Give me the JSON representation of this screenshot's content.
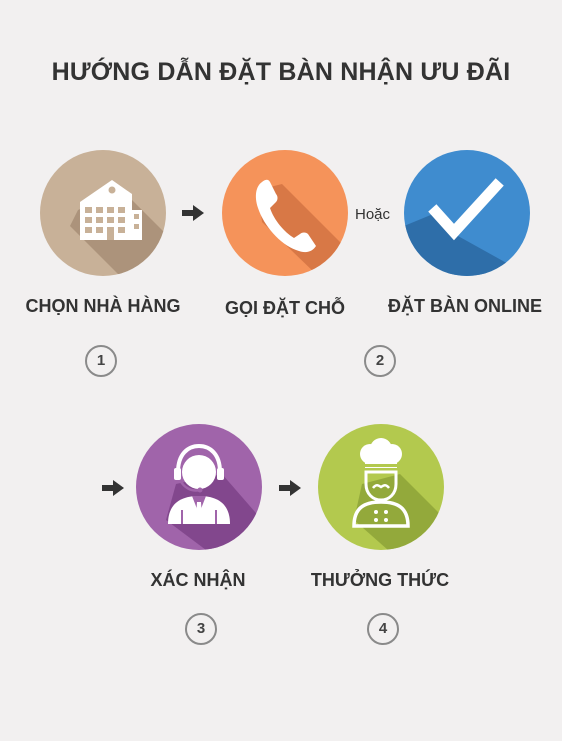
{
  "title": "HƯỚNG DẪN ĐẶT BÀN NHẬN ƯU ĐÃI",
  "or_text": "Hoặc",
  "steps": [
    {
      "label": "CHỌN NHÀ HÀNG",
      "color": "#c8b198",
      "icon": "building-icon"
    },
    {
      "label": "GỌI ĐẶT CHỖ",
      "color": "#f5935a",
      "icon": "phone-icon"
    },
    {
      "label": "ĐẶT BÀN ONLINE",
      "color": "#3f8ccf",
      "icon": "checkmark-icon"
    },
    {
      "label": "XÁC NHẬN",
      "color": "#a064aa",
      "icon": "headset-operator-icon"
    },
    {
      "label": "THƯỞNG THỨC",
      "color": "#b3c94e",
      "icon": "chef-icon"
    }
  ],
  "numbers": [
    "1",
    "2",
    "3",
    "4"
  ]
}
